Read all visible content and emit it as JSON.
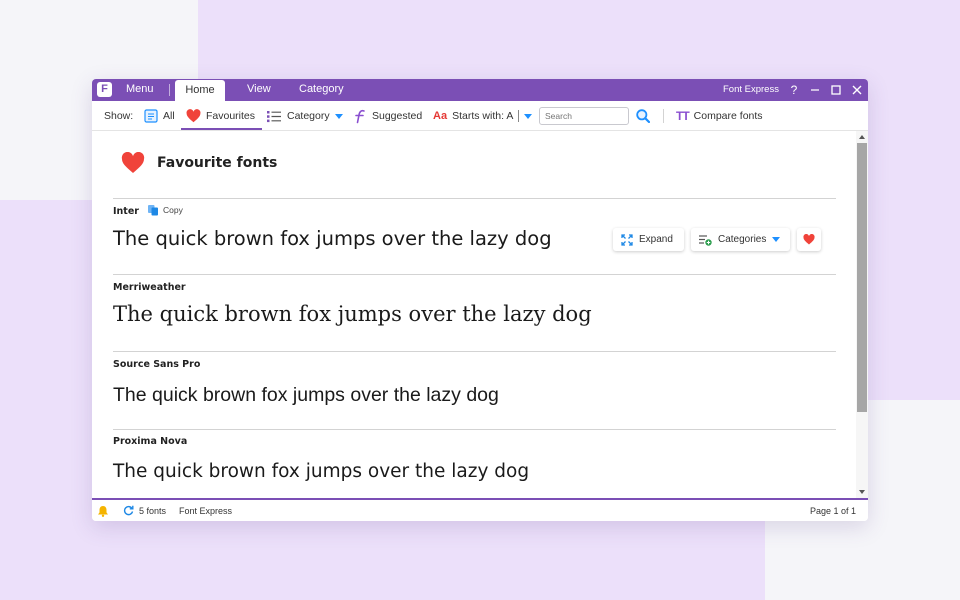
{
  "titlebar": {
    "logo_letter": "F",
    "tabs": {
      "menu": "Menu",
      "home": "Home",
      "view": "View",
      "category": "Category"
    },
    "app_name": "Font Express",
    "help": "?"
  },
  "ribbon": {
    "show_label": "Show:",
    "all": "All",
    "favourites": "Favourites",
    "category": "Category",
    "suggested": "Suggested",
    "starts_with_icon_text": "Aa",
    "starts_with": "Starts with: A",
    "search_placeholder": "Search",
    "compare_icon_text": "TT",
    "compare": "Compare fonts"
  },
  "content": {
    "heading": "Favourite fonts",
    "fonts": [
      {
        "name": "Inter",
        "sample": "The quick brown fox jumps over the lazy dog"
      },
      {
        "name": "Merriweather",
        "sample": "The quick brown fox jumps over the lazy dog"
      },
      {
        "name": "Source Sans Pro",
        "sample": "The quick brown fox jumps over the lazy dog"
      },
      {
        "name": "Proxima Nova",
        "sample": "The quick brown fox jumps over the lazy dog"
      }
    ],
    "copy_label": "Copy",
    "expand_label": "Expand",
    "categories_label": "Categories"
  },
  "statusbar": {
    "font_count": "5 fonts",
    "app_name": "Font Express",
    "page": "Page 1 of 1"
  },
  "colors": {
    "brand_purple": "#7b4fb5",
    "heart_red": "#f0433a",
    "accent_blue": "#1e90ff",
    "background": "#ece0fa"
  }
}
